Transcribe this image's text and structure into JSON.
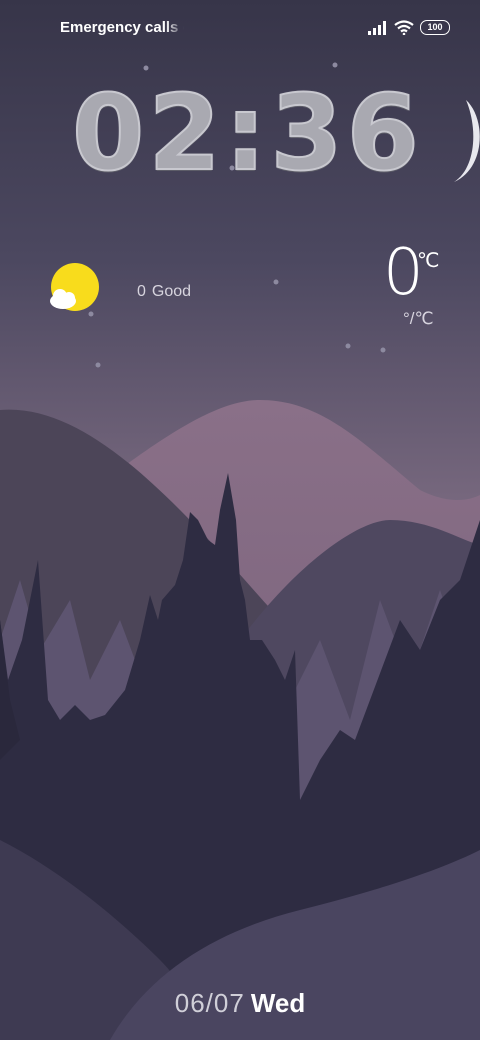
{
  "status_bar": {
    "carrier_text": "Emergency calls o",
    "battery_level": "100",
    "signal_icon": "signal-bars-icon",
    "wifi_icon": "wifi-icon"
  },
  "clock": {
    "time": "02:36"
  },
  "weather": {
    "icon": "sun-behind-cloud-icon",
    "aqi_value": "0",
    "aqi_label": "Good",
    "temperature": "0",
    "temperature_unit": "℃",
    "range": "°/℃"
  },
  "date": {
    "date": "06/07",
    "weekday": "Wed"
  },
  "colors": {
    "sky_top": "#373549",
    "sky_bottom": "#7a6a80",
    "sun": "#f8dc1c"
  }
}
